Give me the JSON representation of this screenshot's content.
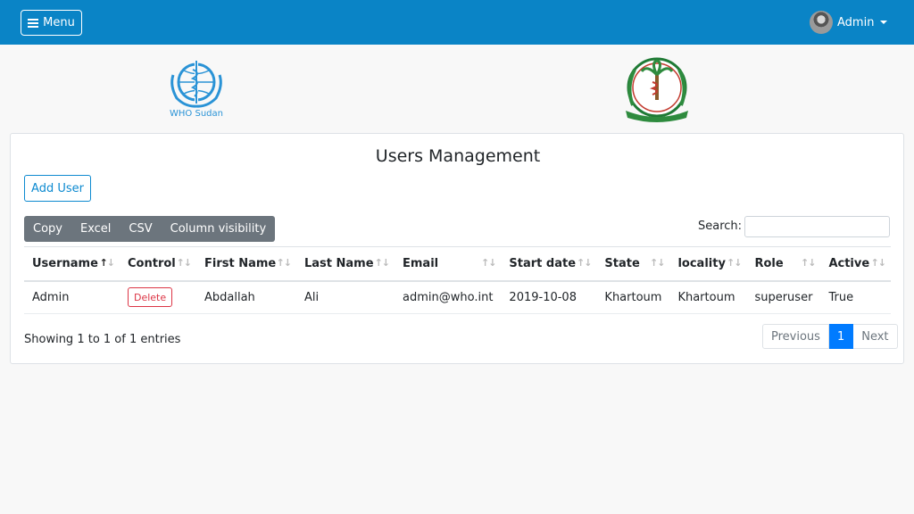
{
  "navbar": {
    "menu_label": "Menu",
    "user_label": "Admin",
    "bg_color": "#0a84c6"
  },
  "logos": {
    "who_text": "WHO Sudan",
    "moh_emblem": "moh-emblem-icon"
  },
  "card": {
    "title": "Users Management",
    "add_user_label": "Add User",
    "export_buttons": [
      "Copy",
      "Excel",
      "CSV",
      "Column visibility"
    ],
    "search_label": "Search:",
    "search_value": ""
  },
  "table": {
    "columns": [
      "Username",
      "Control",
      "First Name",
      "Last Name",
      "Email",
      "Start date",
      "State",
      "locality",
      "Role",
      "Active"
    ],
    "rows": [
      {
        "username": "Admin",
        "control": "Delete",
        "first_name": "Abdallah",
        "last_name": "Ali",
        "email": "admin@who.int",
        "start_date": "2019-10-08",
        "state": "Khartoum",
        "locality": "Khartoum",
        "role": "superuser",
        "active": "True"
      }
    ]
  },
  "footer": {
    "info": "Showing 1 to 1 of 1 entries",
    "prev": "Previous",
    "current_page": "1",
    "next": "Next"
  }
}
